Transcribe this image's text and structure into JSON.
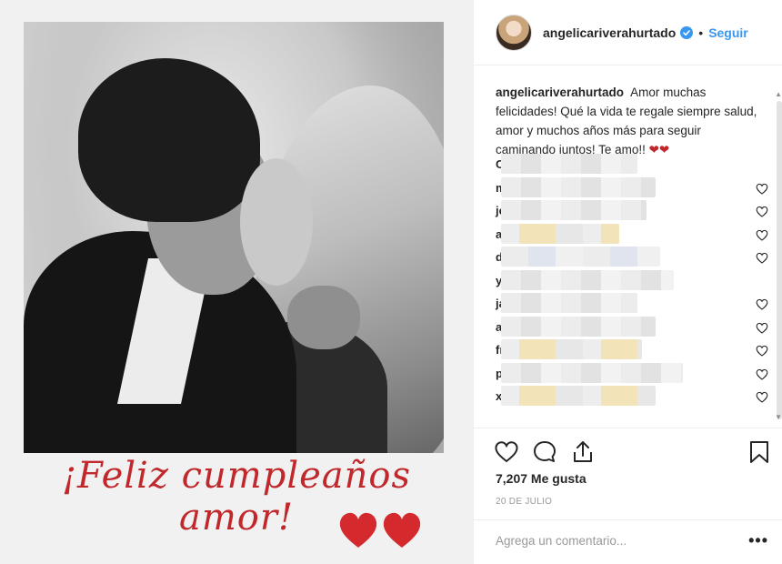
{
  "post": {
    "image_text": {
      "greeting": "¡Feliz cumpleaños amor!"
    }
  },
  "header": {
    "username": "angelicariverahurtado",
    "separator": "•",
    "follow_label": "Seguir"
  },
  "caption": {
    "author": "angelicariverahurtado",
    "text": "Amor muchas felicidades! Qué la vida te regale siempre salud, amor y muchos años más para seguir caminando juntos! Te amo!!",
    "emoji": "❤❤"
  },
  "comments": [
    {
      "initial": "C",
      "tint": "plain",
      "liked_icon": false
    },
    {
      "initial": "m",
      "tint": "plain",
      "liked_icon": true
    },
    {
      "initial": "je",
      "tint": "plain",
      "liked_icon": true
    },
    {
      "initial": "a",
      "tint": "tinted",
      "liked_icon": true
    },
    {
      "initial": "d",
      "tint": "bluish",
      "liked_icon": true
    },
    {
      "initial": "y",
      "tint": "plain",
      "liked_icon": false
    },
    {
      "initial": "ja",
      "tint": "plain",
      "liked_icon": true
    },
    {
      "initial": "a",
      "tint": "plain",
      "liked_icon": true
    },
    {
      "initial": "fı",
      "tint": "tinted",
      "liked_icon": true
    },
    {
      "initial": "p",
      "tint": "plain",
      "liked_icon": true
    },
    {
      "initial": "x",
      "tint": "tinted",
      "liked_icon": true
    }
  ],
  "actions": {
    "likes": "7,207 Me gusta",
    "date": "20 DE JULIO",
    "comment_placeholder": "Agrega un comentario...",
    "more_label": "•••"
  },
  "icons": {
    "like": "heart-outline-icon",
    "comment": "speech-bubble-icon",
    "share": "share-arrow-icon",
    "save": "bookmark-icon",
    "verified": "verified-badge-icon"
  },
  "colors": {
    "accent_blue": "#3897f0",
    "greeting_red": "#c0282c",
    "text": "#262626",
    "muted": "#999999"
  }
}
